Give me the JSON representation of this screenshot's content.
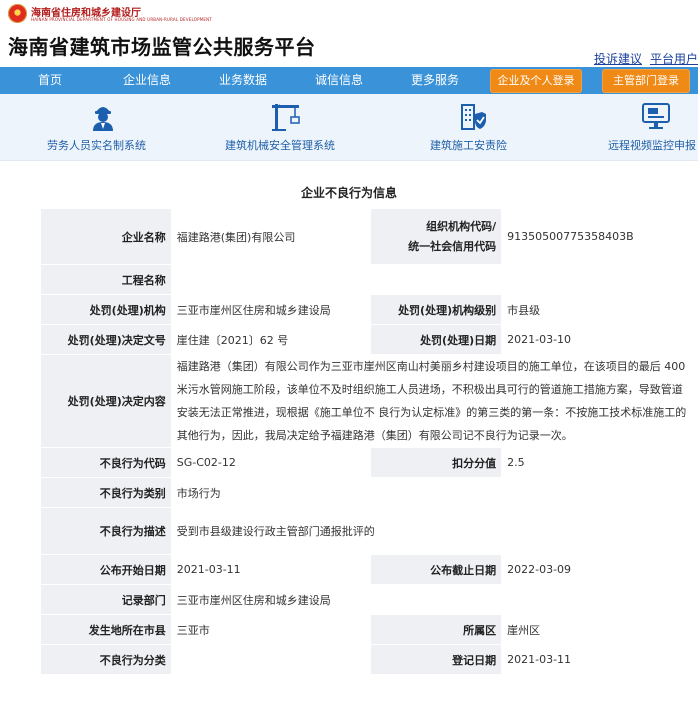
{
  "header": {
    "dept_name_cn": "海南省住房和城乡建设厅",
    "dept_name_en": "HAINAN PROVINCIAL DEPARTMENT OF HOUSING AND URBAN-RURAL DEVELOPMENT",
    "site_title": "海南省建筑市场监管公共服务平台",
    "links": [
      "投诉建议",
      "平台用户"
    ]
  },
  "nav": {
    "items": [
      "首页",
      "企业信息",
      "业务数据",
      "诚信信息",
      "更多服务"
    ],
    "login_buttons": [
      "企业及个人登录",
      "主管部门登录"
    ]
  },
  "systems": [
    {
      "label": "劳务人员实名制系统",
      "icon": "worker-icon"
    },
    {
      "label": "建筑机械安全管理系统",
      "icon": "crane-icon"
    },
    {
      "label": "建筑施工安责险",
      "icon": "building-shield-icon"
    },
    {
      "label": "远程视频监控申报",
      "icon": "monitor-icon"
    }
  ],
  "section_title": "企业不良行为信息",
  "record": {
    "company_label": "企业名称",
    "company": "福建路港(集团)有限公司",
    "org_code_label_1": "组织机构代码/",
    "org_code_label_2": "统一社会信用代码",
    "org_code": "91350500775358403B",
    "project_label": "工程名称",
    "project": "",
    "authority_label": "处罚(处理)机构",
    "authority": "三亚市崖州区住房和城乡建设局",
    "authority_level_label": "处罚(处理)机构级别",
    "authority_level": "市县级",
    "doc_no_label": "处罚(处理)决定文号",
    "doc_no": "崖住建〔2021〕62 号",
    "date_label": "处罚(处理)日期",
    "date": "2021-03-10",
    "content_label": "处罚(处理)决定内容",
    "content": "福建路港（集团）有限公司作为三亚市崖州区南山村美丽乡村建设项目的施工单位，在该项目的最后 400米污水管网施工阶段，该单位不及时组织施工人员进场，不积极出具可行的管道施工措施方案，导致管道安装无法正常推进，现根据《施工单位不 良行为认定标准》的第三类的第一条：不按施工技术标准施工的其他行为，因此，我局决定给予福建路港（集团）有限公司记不良行为记录一次。",
    "bad_code_label": "不良行为代码",
    "bad_code": "SG-C02-12",
    "score_label": "扣分分值",
    "score": "2.5",
    "category_label": "不良行为类别",
    "category": "市场行为",
    "desc_label": "不良行为描述",
    "desc": "受到市县级建设行政主管部门通报批评的",
    "pub_start_label": "公布开始日期",
    "pub_start": "2021-03-11",
    "pub_end_label": "公布截止日期",
    "pub_end": "2022-03-09",
    "record_dept_label": "记录部门",
    "record_dept": "三亚市崖州区住房和城乡建设局",
    "city_label": "发生地所在市县",
    "city": "三亚市",
    "district_label": "所属区",
    "district": "崖州区",
    "class_label": "不良行为分类",
    "class": "",
    "reg_date_label": "登记日期",
    "reg_date": "2021-03-11"
  },
  "colors": {
    "nav_bg": "#3a92d8",
    "login_btn": "#f08a16",
    "label_bg": "#eef0f3",
    "system_bar_bg": "#eef4fb",
    "link": "#1a3f9c"
  }
}
